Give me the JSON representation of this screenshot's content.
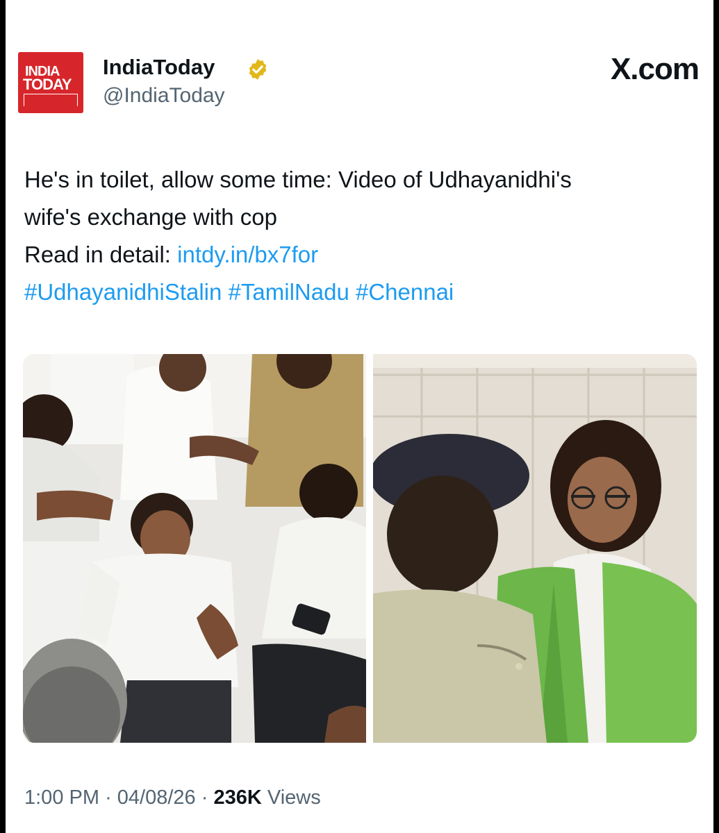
{
  "author": {
    "display_name": "IndiaToday",
    "handle": "@IndiaToday",
    "logo_text_line1": "INDIA",
    "logo_text_line2": "TODAY",
    "verified_badge_icon": "verified-badge-icon",
    "brand_color": "#d7262b"
  },
  "source": {
    "label": "X.com"
  },
  "post": {
    "headline_line1": "He's in toilet, allow some time: Video of Udhayanidhi's",
    "headline_line2": "wife's exchange with cop",
    "read_label": "Read in detail: ",
    "link_text": "intdy.in/bx7for",
    "hashtags": [
      "#UdhayanidhiStalin",
      "#TamilNadu",
      "#Chennai"
    ],
    "link_color": "#1d9bf0"
  },
  "media": {
    "images": [
      {
        "name": "group-photo"
      },
      {
        "name": "woman-with-cop-photo"
      }
    ]
  },
  "meta": {
    "time": "1:00 PM",
    "separator": "·",
    "date": "04/08/26",
    "views_count": "236K",
    "views_label": "Views"
  }
}
